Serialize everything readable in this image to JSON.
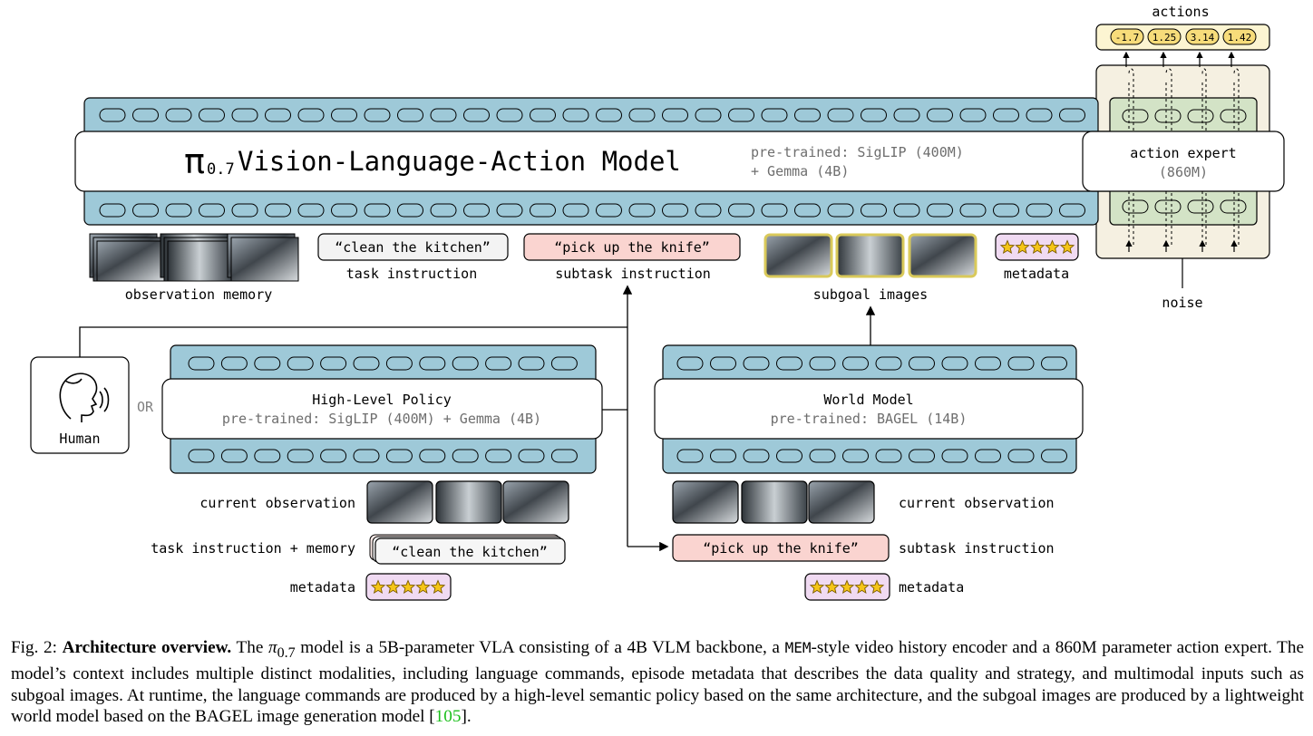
{
  "main_model": {
    "pi_symbol": "π",
    "pi_subscript": "0.7",
    "title": "Vision-Language-Action Model",
    "pretrained_line1": "pre-trained: SigLIP (400M)",
    "pretrained_line2": "+ Gemma (4B)"
  },
  "action_expert": {
    "title": "action expert",
    "size": "(860M)",
    "actions_label": "actions",
    "action_values": [
      "-1.7",
      "1.25",
      "3.14",
      "1.42"
    ],
    "noise_label": "noise"
  },
  "inputs": {
    "observation_memory": "observation memory",
    "task_text": "“clean the kitchen”",
    "task_label": "task instruction",
    "subtask_text": "“pick up the knife”",
    "subtask_label": "subtask instruction",
    "subgoal_label": "subgoal images",
    "metadata_label": "metadata"
  },
  "human": {
    "label": "Human",
    "or": "OR"
  },
  "high_level_policy": {
    "title": "High-Level Policy",
    "pretrained": "pre-trained: SigLIP (400M) + Gemma (4B)",
    "current_observation": "current observation",
    "task_memory_label": "task instruction + memory",
    "task_text": "“clean the kitchen”",
    "metadata_label": "metadata"
  },
  "world_model": {
    "title": "World Model",
    "pretrained": "pre-trained: BAGEL (14B)",
    "current_observation": "current observation",
    "subtask_text": "“pick up the knife”",
    "subtask_label": "subtask instruction",
    "metadata_label": "metadata"
  },
  "caption": {
    "fig": "Fig. 2:",
    "heading": "Architecture overview.",
    "part1": "The",
    "pi": "π",
    "pi_sub": "0.7",
    "part2": "model is a 5B-parameter VLA consisting of a 4B VLM backbone, a",
    "mem": "MEM",
    "part3": "-style video history encoder and a 860M parameter action expert. The model’s context includes multiple distinct modalities, including language commands, episode metadata that describes the data quality and strategy, and multimodal inputs such as subgoal images. At runtime, the language commands are produced by a high-level semantic policy based on the same architecture, and the subgoal images are produced by a lightweight world model based on the BAGEL image generation model [",
    "cite": "105",
    "part4": "]."
  },
  "colors": {
    "token_bar": "#9ec9d8",
    "action_panel": "#f5f0e1",
    "action_inner": "#d3e3c6",
    "action_value": "#f7dc7a",
    "subtask_bg": "#fad4d0",
    "metadata_bg": "#f0daf2",
    "star": "#f5c518",
    "subgoal_border": "#d9c95a"
  }
}
